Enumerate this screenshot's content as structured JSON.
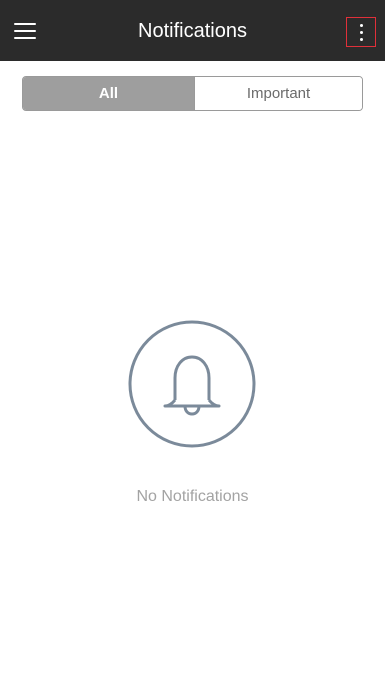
{
  "header": {
    "title": "Notifications",
    "menu_icon": "hamburger-menu-icon",
    "more_icon": "more-vertical-icon"
  },
  "tabs": [
    {
      "label": "All",
      "selected": true
    },
    {
      "label": "Important",
      "selected": false
    }
  ],
  "empty_state": {
    "icon": "bell-icon",
    "message": "No Notifications"
  },
  "colors": {
    "topbar": "#2b2b2b",
    "tab_selected_bg": "#9e9e9e",
    "icon_stroke": "#7b8a9a",
    "highlight_border": "#e0303a"
  }
}
